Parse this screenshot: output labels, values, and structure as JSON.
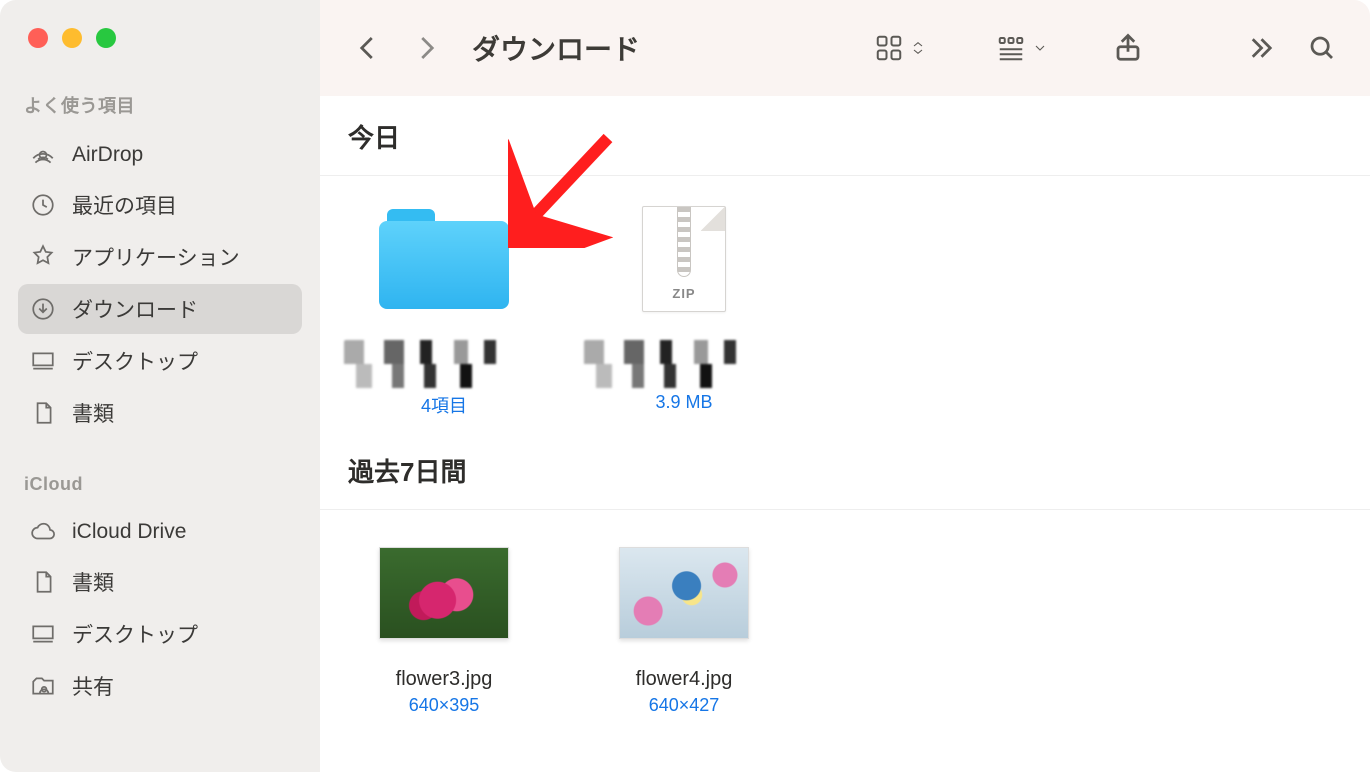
{
  "window_title": "ダウンロード",
  "sidebar": {
    "section_favorites": "よく使う項目",
    "section_icloud": "iCloud",
    "items_fav": [
      {
        "icon": "airdrop",
        "label": "AirDrop"
      },
      {
        "icon": "clock",
        "label": "最近の項目"
      },
      {
        "icon": "apps",
        "label": "アプリケーション"
      },
      {
        "icon": "download",
        "label": "ダウンロード",
        "selected": true
      },
      {
        "icon": "desktop",
        "label": "デスクトップ"
      },
      {
        "icon": "doc",
        "label": "書類"
      }
    ],
    "items_icloud": [
      {
        "icon": "cloud",
        "label": "iCloud Drive"
      },
      {
        "icon": "doc",
        "label": "書類"
      },
      {
        "icon": "desktop",
        "label": "デスクトップ"
      },
      {
        "icon": "shared",
        "label": "共有"
      }
    ]
  },
  "groups": [
    {
      "title": "今日",
      "items": [
        {
          "kind": "folder",
          "name_hidden": true,
          "sub": "4項目"
        },
        {
          "kind": "zip",
          "zip_badge": "ZIP",
          "name_hidden": true,
          "sub": "3.9 MB"
        }
      ]
    },
    {
      "title": "過去7日間",
      "items": [
        {
          "kind": "image",
          "name": "flower3.jpg",
          "sub": "640×395",
          "img": "flower3"
        },
        {
          "kind": "image",
          "name": "flower4.jpg",
          "sub": "640×427",
          "img": "flower4"
        }
      ]
    }
  ]
}
